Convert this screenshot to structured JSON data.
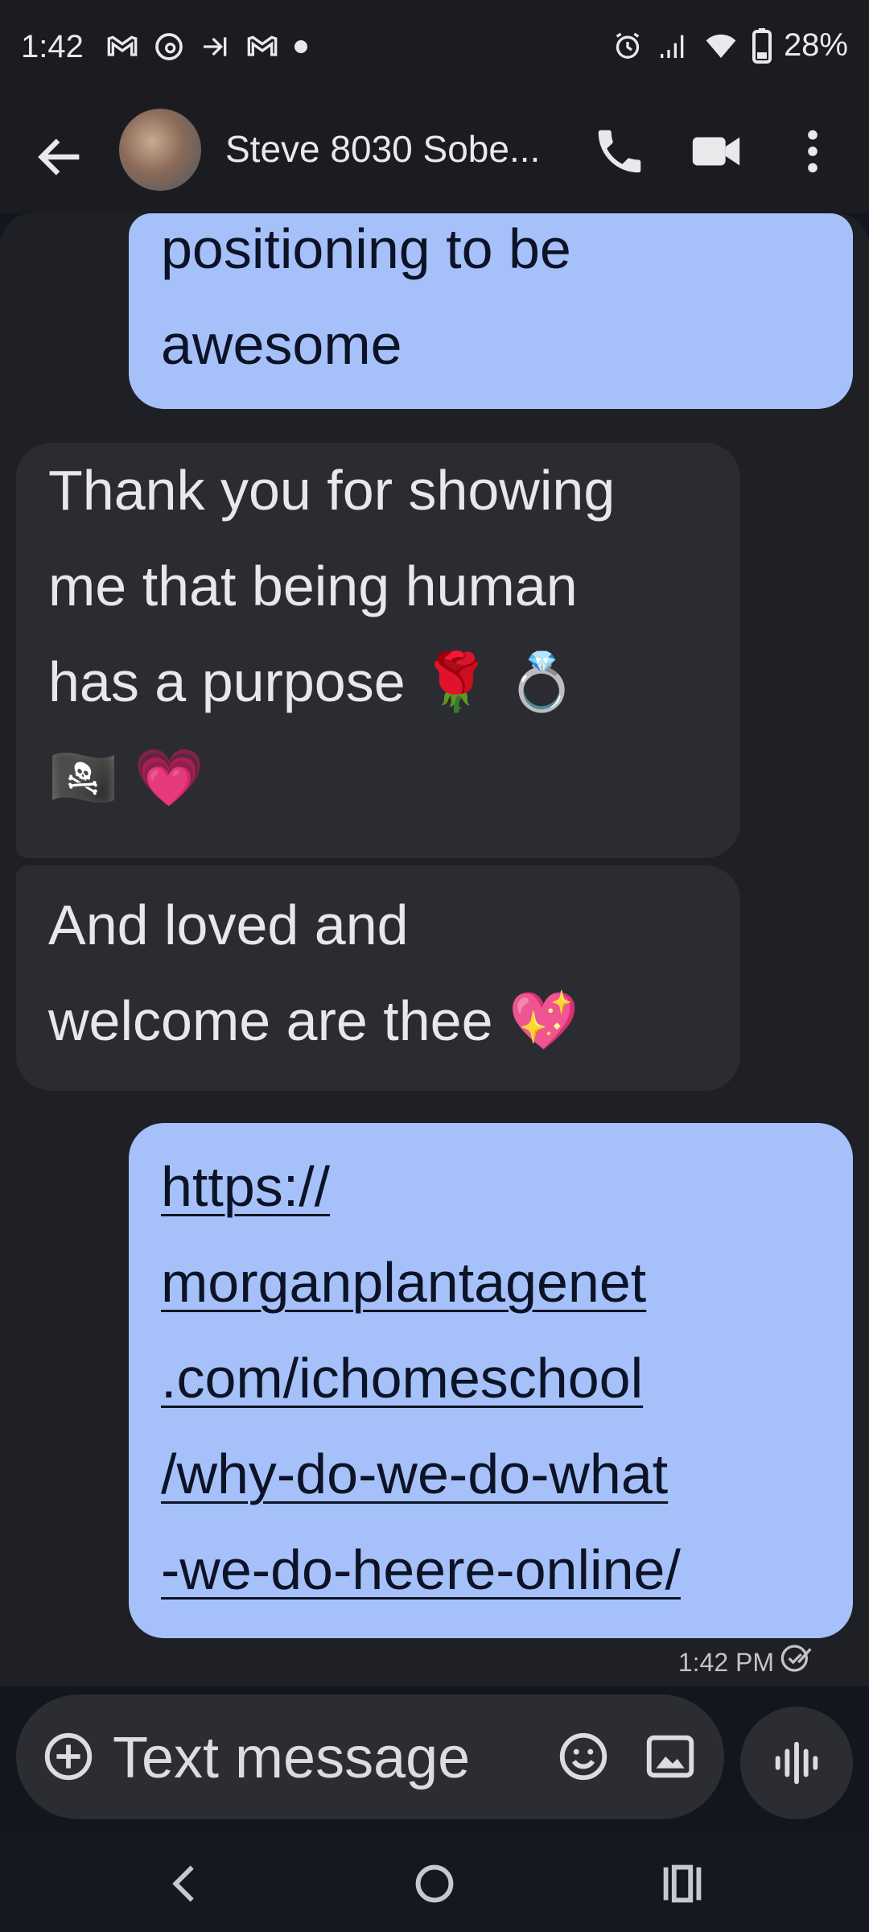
{
  "status_bar": {
    "time": "1:42",
    "left_icons": [
      "gmail-icon",
      "threads-icon",
      "data-icon",
      "gmail-icon",
      "dot-icon"
    ],
    "right_icons": [
      "alarm-icon",
      "signal-icon",
      "wifi-icon",
      "battery-icon"
    ],
    "battery": "28%"
  },
  "header": {
    "contact_name": "Steve 8030 Sobe...",
    "icons": [
      "back-arrow-icon",
      "phone-icon",
      "video-icon",
      "more-vert-icon"
    ]
  },
  "messages": [
    {
      "direction": "sent",
      "lines": [
        "positioning to be",
        "awesome"
      ]
    },
    {
      "direction": "received",
      "lines": [
        "Thank you for showing",
        "me that being human",
        "has a purpose 🌹 💍",
        "🏴‍☠️ 💗"
      ]
    },
    {
      "direction": "received",
      "lines": [
        "And loved and",
        "welcome are thee 💖"
      ]
    },
    {
      "direction": "sent",
      "link": true,
      "lines": [
        "https://",
        "morganplantagenet",
        ".com/ichomeschool",
        "/why-do-we-do-what",
        "-we-do-heere-online/"
      ]
    }
  ],
  "timestamp": "1:42 PM",
  "composer": {
    "placeholder": "Text message"
  },
  "colors": {
    "sent_bubble": "#a6c1fa",
    "received_bubble": "#2b2c31",
    "background": "#1f2026"
  }
}
